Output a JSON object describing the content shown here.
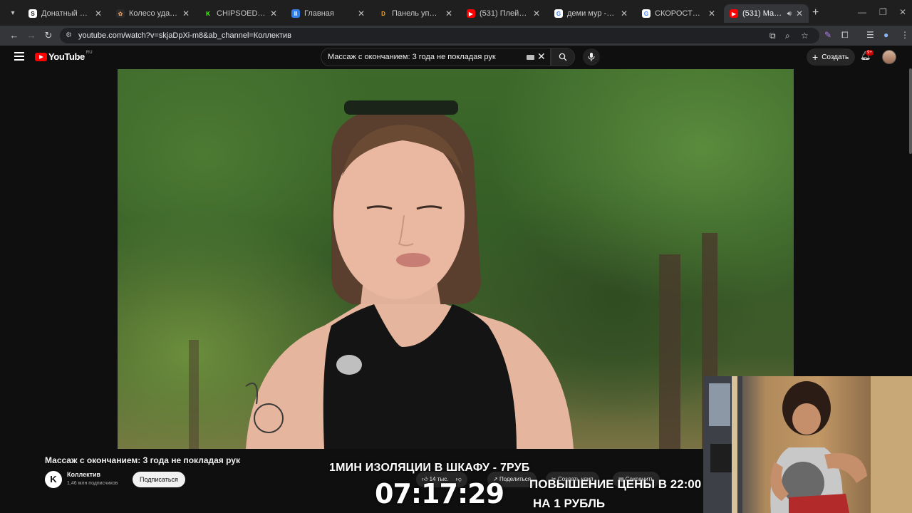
{
  "browser": {
    "tabs": [
      {
        "title": "Донатный таймер (п",
        "favicon_letter": "S",
        "favicon_color": "#ffffff",
        "favicon_text": "#111111",
        "active": false
      },
      {
        "title": "Колесо удачи | Опре",
        "favicon_letter": "✿",
        "favicon_color": "#2b2b2b",
        "favicon_text": "#f4a261",
        "active": false
      },
      {
        "title": "CHIPSOED196 Stream",
        "favicon_letter": "K",
        "favicon_color": "#1f1f1f",
        "favicon_text": "#53fc18",
        "active": false
      },
      {
        "title": "Главная",
        "favicon_letter": "II",
        "favicon_color": "#2f80ed",
        "favicon_text": "#ffffff",
        "active": false
      },
      {
        "title": "Панель управления",
        "favicon_letter": "D",
        "favicon_color": "#1f1f1f",
        "favicon_text": "#f5a623",
        "active": false
      },
      {
        "title": "(531) Плейлист с но",
        "favicon_letter": "▶",
        "favicon_color": "#ff0000",
        "favicon_text": "#ffffff",
        "active": false
      },
      {
        "title": "деми мур - Поиск в",
        "favicon_letter": "G",
        "favicon_color": "#ffffff",
        "favicon_text": "#4285f4",
        "active": false
      },
      {
        "title": "СКОРОСТЬ ИНТЕРНЕ",
        "favicon_letter": "G",
        "favicon_color": "#ffffff",
        "favicon_text": "#4285f4",
        "active": false
      },
      {
        "title": "(531) Массаж с о",
        "favicon_letter": "▶",
        "favicon_color": "#ff0000",
        "favicon_text": "#ffffff",
        "active": true
      }
    ],
    "url": "youtube.com/watch?v=skjaDpXi-m8&ab_channel=Коллектив"
  },
  "youtube": {
    "logo_text": "YouTube",
    "country": "RU",
    "search_value": "Массаж с окончанием: 3 года не покладая рук",
    "create_label": "Создать",
    "notifications_badge": "9+"
  },
  "video": {
    "title": "Массаж с окончанием: 3 года не покладая рук",
    "channel_name": "Коллектив",
    "channel_initial": "K",
    "subscribers": "1,46 млн подписчиков",
    "subscribe_label": "Подписаться",
    "likes": "14 тыс.",
    "share_label": "Поделиться",
    "clip_label": "Создать клип",
    "save_label": "Сохранить"
  },
  "stream_overlay": {
    "promo_line1": "1МИН ИЗОЛЯЦИИ В ШКАФУ - 7РУБ",
    "timer": "07:17:29",
    "promo_line2": "ПОВЫШЕНИЕ ЦЕНЫ В 22:00",
    "promo_line3": "НА 1 РУБЛЬ"
  }
}
